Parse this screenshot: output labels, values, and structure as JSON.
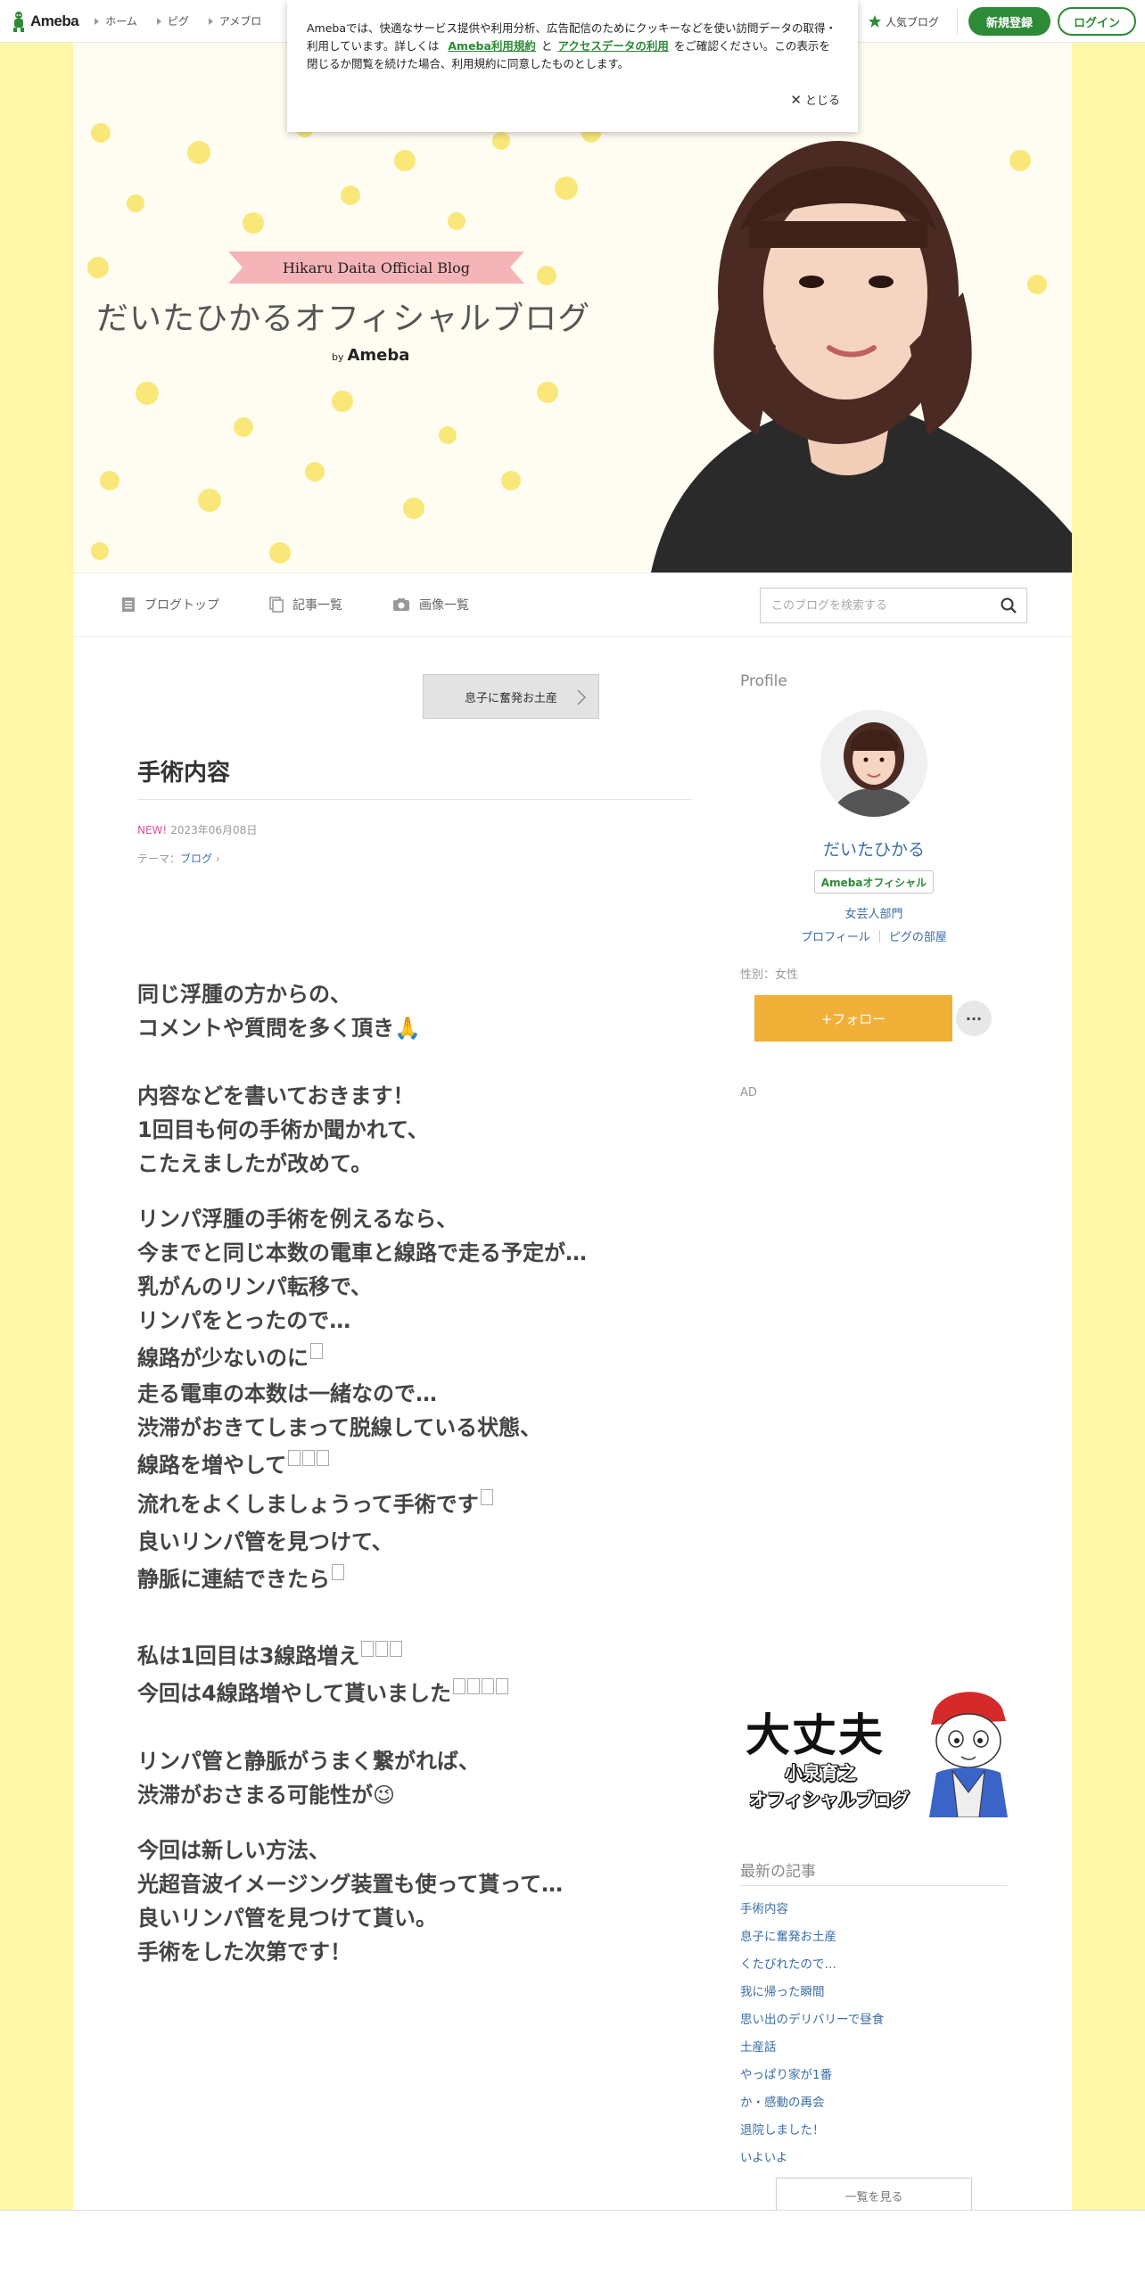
{
  "topbar": {
    "logo_text": "Ameba",
    "nav": [
      "ホーム",
      "ピグ",
      "アメブロ"
    ],
    "popular_label": "人気ブログ",
    "register_label": "新規登録",
    "login_label": "ログイン",
    "accent_color": "#2d8a36"
  },
  "cookie": {
    "text_before": "Amebaでは、快適なサービス提供や利用分析、広告配信のためにクッキーなどを使い訪問データの取得・利用しています。詳しくは",
    "link1": "Ameba利用規約",
    "and": "と",
    "link2": "アクセスデータの利用",
    "text_after": "をご確認ください。この表示を閉じるか閲覧を続けた場合、利用規約に同意したものとします。",
    "close_label": "とじる"
  },
  "banner": {
    "ribbon": "Hikaru Daita Official Blog",
    "title": "だいたひかるオフィシャルブログ",
    "by": "by",
    "brand": "Ameba"
  },
  "blognav": {
    "items": [
      "ブログトップ",
      "記事一覧",
      "画像一覧"
    ],
    "search_placeholder": "このブログを検索する"
  },
  "article": {
    "prev_link": "息子に奮発お土産",
    "title": "手術内容",
    "new_badge": "NEW!",
    "date": "2023年06月08日",
    "theme_label": "テーマ：",
    "theme": "ブログ",
    "lines": [
      "同じ浮腫の方からの、",
      "コメントや質問を多く頂き🙏",
      "内容などを書いておきます！",
      "1回目も何の手術か聞かれて、",
      "こたえましたが改めて。",
      "リンパ浮腫の手術を例えるなら、",
      "今までと同じ本数の電車と線路で走る予定が…",
      "乳がんのリンパ転移で、",
      "リンパをとったので…",
      "線路が少ないのに",
      "走る電車の本数は一緒なので…",
      "渋滞がおきてしまって脱線している状態、",
      "線路を増やして",
      "流れをよくしましょうって手術です",
      "良いリンパ管を見つけて、",
      "静脈に連結できたら",
      "私は1回目は3線路増え",
      "今回は4線路増やして貰いました",
      "リンパ管と静脈がうまく繋がれば、",
      "渋滞がおさまる可能性が😉",
      "今回は新しい方法、",
      "光超音波イメージング装置も使って貰って…",
      "良いリンパ管を見つけて貰い。",
      "手術をした次第です！"
    ]
  },
  "sidebar": {
    "profile_heading": "Profile",
    "name": "だいたひかる",
    "badge": "Amebaオフィシャル",
    "category": "女芸人部門",
    "link_profile": "プロフィール",
    "link_pig": "ピグの部屋",
    "gender": "性別：女性",
    "follow_label": "+フォロー",
    "more_label": "···",
    "ad_label": "AD",
    "ad_big": "大丈夫",
    "ad_sub1": "小泉育之",
    "ad_sub2": "オフィシャルブログ",
    "recent_heading": "最新の記事",
    "recent": [
      "手術内容",
      "息子に奮発お土産",
      "くたびれたので…",
      "我に帰った瞬間",
      "思い出のデリバリーで昼食",
      "土産話",
      "やっぱり家が1番",
      "か・感動の再会",
      "退院しました！",
      "いよいよ"
    ],
    "more_list_label": "一覧を見る"
  }
}
